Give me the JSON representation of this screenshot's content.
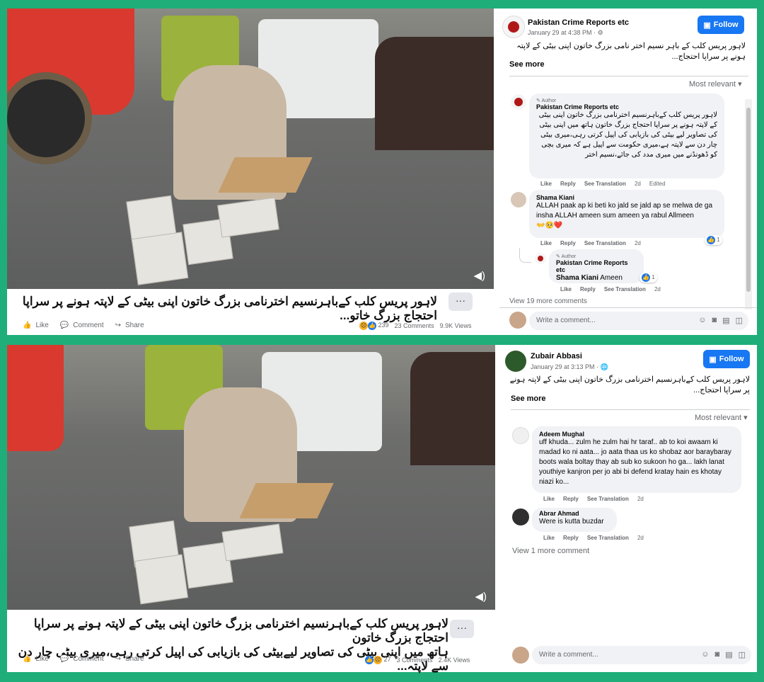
{
  "post1": {
    "caption": "لاہور پریس کلب کےباہرنسیم اخترنامی بزرگ خاتون اپنی بیٹی کے لاپتہ ہونے پر سراپا احتجاج بزرگ خاتو...",
    "more": "···",
    "actions": {
      "like": "Like",
      "comment": "Comment",
      "share": "Share"
    },
    "stats": {
      "reactions": "239",
      "comments": "23 Comments",
      "views": "9.9K Views"
    },
    "page": {
      "name": "Pakistan Crime Reports etc",
      "time": "January 29 at 4:38 PM ·",
      "follow": "Follow"
    },
    "post_text": "لاہور پریس کلب کے باہر نسیم اختر نامی بزرگ خاتون اپنی بیٹی کے لاپتہ ہونے پر سراپا احتجاج...",
    "see_more": "See more",
    "sort": "Most relevant",
    "comments": [
      {
        "author_tag": "Author",
        "name": "Pakistan Crime Reports etc",
        "text": "لاہور پریس کلب کےباہرنسیم اخترنامی بزرگ خاتون اپنی بیٹی کے لاپتہ ہونے پر سراپا احتجاج بزرگ خاتون ہاتھ میں اپنی بیٹی کی تصاویر لیے بیٹی کی بازیابی کی اپیل کرتی رہی،میری بیٹی چار دن سے لاپتہ ہے،میری حکومت سے اپیل ہے کہ میری بچی کو ڈھونڈنے میں میری مدد کی جائے،نسیم اختر",
        "actions": [
          "Like",
          "Reply",
          "See Translation",
          "2d",
          "Edited"
        ]
      },
      {
        "name": "Shama Kiani",
        "text": "ALLAH paak ap ki beti ko jald se jald ap se melwa de ga insha ALLAH ameen sum ameen ya rabul Allmeen",
        "emoji": "👐🥺❤️",
        "actions": [
          "Like",
          "Reply",
          "See Translation",
          "2d"
        ],
        "count": "1"
      },
      {
        "author_tag": "Author",
        "name": "Pakistan Crime Reports etc",
        "mention": "Shama Kiani",
        "text": "Ameen",
        "actions": [
          "Like",
          "Reply",
          "See Translation",
          "2d"
        ],
        "count": "1"
      }
    ],
    "view_more": "View 19 more comments",
    "input_placeholder": "Write a comment..."
  },
  "post2": {
    "caption_line1": "لاہور پریس کلب کےباہرنسیم اخترنامی بزرگ خاتون اپنی بیٹی کے لاپتہ ہونے پر سراپا احتجاج بزرگ خاتون",
    "caption_line2": "ہاتھ میں اپنی بیٹی کی تصاویر لیےبیٹی کی بازیابی کی اپیل کرتی رہی،میری بیٹی چار دن سے لاپتہ...",
    "more": "···",
    "actions": {
      "like": "Like",
      "comment": "Comment",
      "share": "Share"
    },
    "stats": {
      "reactions": "27",
      "comments": "3 Comments",
      "views": "2.4K Views"
    },
    "page": {
      "name": "Zubair Abbasi",
      "time": "January 29 at 3:13 PM ·",
      "follow": "Follow"
    },
    "post_text": "لاہور پریس کلب کےباہرنسیم اخترنامی بزرگ خاتون اپنی بیٹی کے لاپتہ ہونے پر سراپا احتجاج...",
    "see_more": "See more",
    "sort": "Most relevant",
    "comments": [
      {
        "name": "Adeem Mughal",
        "text": "uff khuda... zulm he zulm hai hr taraf.. ab to koi awaam ki madad ko ni aata... jo aata thaa us ko shobaz aor baraybaray boots wala boltay thay ab sub ko sukoon ho ga... lakh lanat youthiye kanjron per jo abi bi defend kratay hain es khotay niazi ko...",
        "actions": [
          "Like",
          "Reply",
          "See Translation",
          "2d"
        ]
      },
      {
        "name": "Abrar Ahmad",
        "text": "Were is kutta buzdar",
        "actions": [
          "Like",
          "Reply",
          "See Translation",
          "2d"
        ]
      }
    ],
    "view_more": "View 1 more comment",
    "input_placeholder": "Write a comment..."
  },
  "colors": {
    "background": "#1fae79",
    "accent": "#1877f2"
  },
  "icons": [
    "volume-icon",
    "like-icon",
    "comment-icon",
    "share-icon",
    "globe-icon",
    "follow-icon",
    "chevron-down-icon",
    "emoji-icon",
    "camera-icon",
    "gif-icon",
    "sticker-icon"
  ]
}
